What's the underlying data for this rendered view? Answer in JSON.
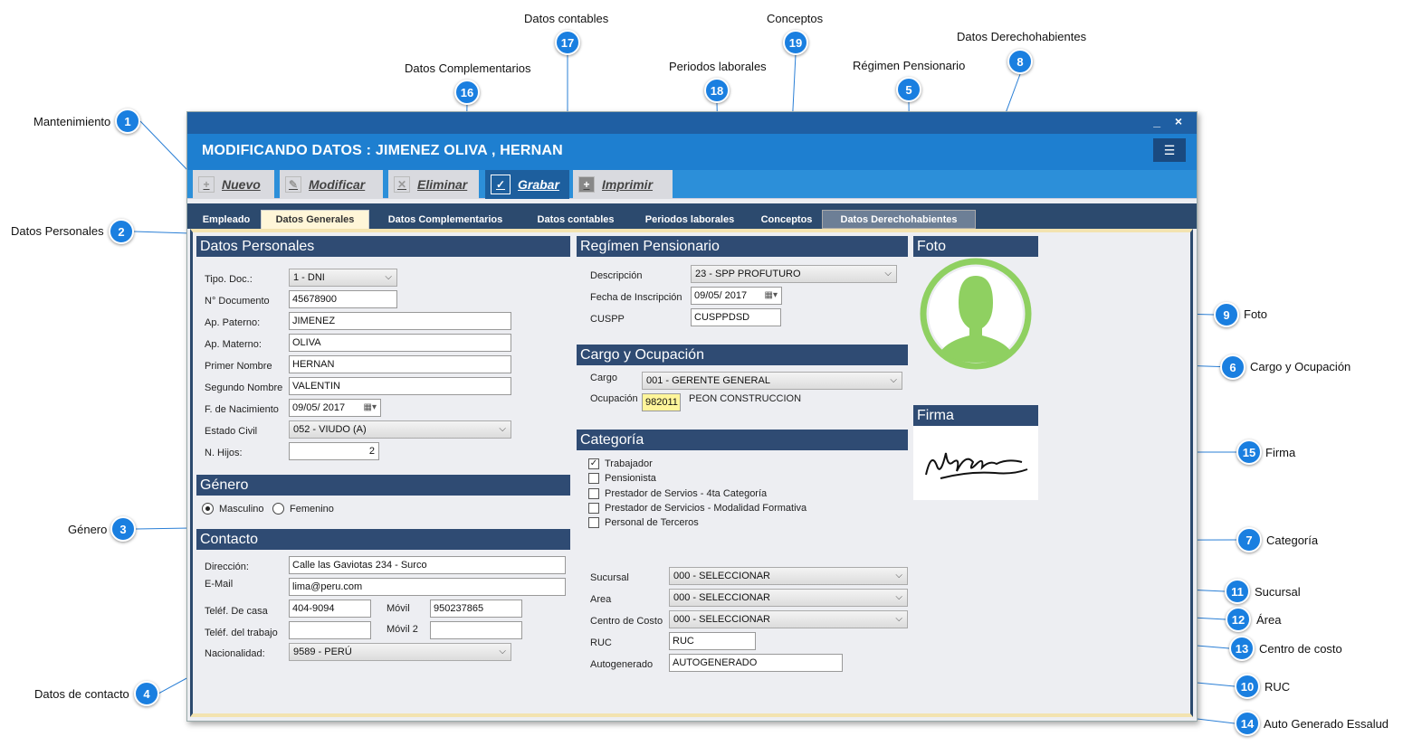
{
  "window": {
    "title": "MODIFICANDO DATOS : JIMENEZ OLIVA , HERNAN",
    "minimize": "_",
    "close": "×",
    "menu_icon": "☰"
  },
  "toolbar": {
    "nuevo": "Nuevo",
    "modificar": "Modificar",
    "eliminar": "Eliminar",
    "grabar": "Grabar",
    "imprimir": "Imprimir"
  },
  "tabs": [
    "Empleado",
    "Datos Generales",
    "Datos Complementarios",
    "Datos contables",
    "Periodos laborales",
    "Conceptos",
    "Datos Derechohabientes"
  ],
  "sections": {
    "personales": "Datos Personales",
    "genero": "Género",
    "contacto": "Contacto",
    "pensionario": "Regímen Pensionario",
    "cargo": "Cargo y Ocupación",
    "categoria": "Categoría",
    "foto": "Foto",
    "firma": "Firma"
  },
  "personales": {
    "tipo_doc_label": "Tipo. Doc.:",
    "tipo_doc": "1 - DNI",
    "documento_label": "N° Documento",
    "documento": "45678900",
    "ap_paterno_label": "Ap. Paterno:",
    "ap_paterno": "JIMENEZ",
    "ap_materno_label": "Ap. Materno:",
    "ap_materno": "OLIVA",
    "primer_nombre_label": "Primer Nombre",
    "primer_nombre": "HERNAN",
    "segundo_nombre_label": "Segundo Nombre",
    "segundo_nombre": "VALENTIN",
    "nacimiento_label": "F. de Nacimiento",
    "nacimiento": "09/05/ 2017",
    "estado_civil_label": "Estado Civil",
    "estado_civil": "052 - VIUDO (A)",
    "hijos_label": "N. Hijos:",
    "hijos": "2"
  },
  "genero": {
    "masculino": "Masculino",
    "femenino": "Femenino",
    "selected": "Masculino"
  },
  "contacto": {
    "direccion_label": "Dirección:",
    "direccion": "Calle las Gaviotas 234 - Surco",
    "email_label": "E-Mail",
    "email": "lima@peru.com",
    "tel_casa_label": "Teléf. De casa",
    "tel_casa": "404-9094",
    "movil_label": "Móvil",
    "movil": "950237865",
    "tel_trabajo_label": "Teléf. del trabajo",
    "tel_trabajo": "",
    "movil2_label": "Móvil 2",
    "movil2": "",
    "nacionalidad_label": "Nacionalidad:",
    "nacionalidad": "9589 - PERÚ"
  },
  "pensionario": {
    "descripcion_label": "Descripción",
    "descripcion": "23 - SPP PROFUTURO",
    "inscripcion_label": "Fecha de Inscripción",
    "inscripcion": "09/05/ 2017",
    "cuspp_label": "CUSPP",
    "cuspp": "CUSPPDSD"
  },
  "cargo": {
    "cargo_label": "Cargo",
    "cargo": "001 - GERENTE GENERAL",
    "ocupacion_label": "Ocupación",
    "ocupacion_code": "982011",
    "ocupacion_desc": "PEON CONSTRUCCION"
  },
  "categoria": {
    "items": [
      {
        "label": "Trabajador",
        "checked": true
      },
      {
        "label": "Pensionista",
        "checked": false
      },
      {
        "label": "Prestador de Servios - 4ta Categoría",
        "checked": false
      },
      {
        "label": "Prestador de Servicios - Modalidad Formativa",
        "checked": false
      },
      {
        "label": "Personal de Terceros",
        "checked": false
      }
    ]
  },
  "extra": {
    "sucursal_label": "Sucursal",
    "sucursal": "000 - SELECCIONAR",
    "area_label": "Area",
    "area": "000 - SELECCIONAR",
    "centro_label": "Centro de Costo",
    "centro": "000 - SELECCIONAR",
    "ruc_label": "RUC",
    "ruc": "RUC",
    "autogenerado_label": "Autogenerado",
    "autogenerado": "AUTOGENERADO"
  },
  "callouts": [
    {
      "n": "1",
      "label": "Mantenimiento"
    },
    {
      "n": "2",
      "label": "Datos Personales"
    },
    {
      "n": "3",
      "label": "Género"
    },
    {
      "n": "4",
      "label": "Datos de contacto"
    },
    {
      "n": "5",
      "label": "Régimen Pensionario"
    },
    {
      "n": "6",
      "label": "Cargo y Ocupación"
    },
    {
      "n": "7",
      "label": "Categoría"
    },
    {
      "n": "8",
      "label": "Datos Derechohabientes"
    },
    {
      "n": "9",
      "label": "Foto"
    },
    {
      "n": "10",
      "label": "RUC"
    },
    {
      "n": "11",
      "label": "Sucursal"
    },
    {
      "n": "12",
      "label": "Área"
    },
    {
      "n": "13",
      "label": "Centro de costo"
    },
    {
      "n": "14",
      "label": "Auto Generado Essalud"
    },
    {
      "n": "15",
      "label": "Firma"
    },
    {
      "n": "16",
      "label": "Datos Complementarios"
    },
    {
      "n": "17",
      "label": "Datos contables"
    },
    {
      "n": "18",
      "label": "Periodos laborales"
    },
    {
      "n": "19",
      "label": "Conceptos"
    }
  ],
  "colors": {
    "callout": "#1a7fe0",
    "header": "#1e7fd0",
    "section": "#2f4b73",
    "tabbar": "#2c4a6e"
  }
}
